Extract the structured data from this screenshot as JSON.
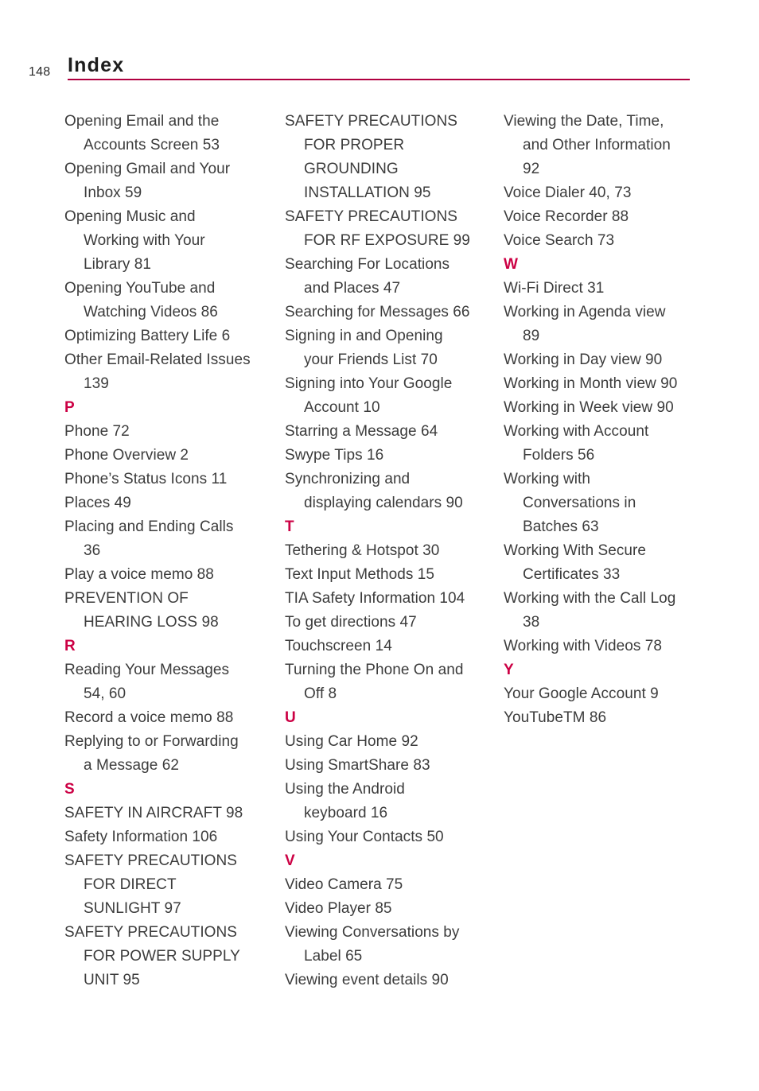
{
  "header": {
    "page_number": "148",
    "title": "Index",
    "rule_color": "#b00040"
  },
  "theme": {
    "letter_heading_color": "#cc0044",
    "text_color": "#3c3c3c",
    "background": "#ffffff"
  },
  "columns": [
    {
      "id": "column-1",
      "lines": [
        {
          "type": "entry",
          "text": "Opening Email and the",
          "indent": false
        },
        {
          "type": "entry",
          "text": "Accounts Screen 53",
          "indent": true
        },
        {
          "type": "entry",
          "text": "Opening Gmail and Your",
          "indent": false
        },
        {
          "type": "entry",
          "text": "Inbox 59",
          "indent": true
        },
        {
          "type": "entry",
          "text": "Opening Music and",
          "indent": false
        },
        {
          "type": "entry",
          "text": "Working with Your",
          "indent": true
        },
        {
          "type": "entry",
          "text": "Library 81",
          "indent": true
        },
        {
          "type": "entry",
          "text": "Opening YouTube and",
          "indent": false
        },
        {
          "type": "entry",
          "text": "Watching Videos 86",
          "indent": true
        },
        {
          "type": "entry",
          "text": "Optimizing Battery Life 6",
          "indent": false
        },
        {
          "type": "entry",
          "text": "Other Email-Related Issues",
          "indent": false
        },
        {
          "type": "entry",
          "text": "139",
          "indent": true
        },
        {
          "type": "letter",
          "text": "P",
          "indent": false
        },
        {
          "type": "entry",
          "text": "Phone 72",
          "indent": false
        },
        {
          "type": "entry",
          "text": "Phone Overview 2",
          "indent": false
        },
        {
          "type": "entry",
          "text": "Phone’s Status Icons 11",
          "indent": false
        },
        {
          "type": "entry",
          "text": "Places 49",
          "indent": false
        },
        {
          "type": "entry",
          "text": "Placing and Ending Calls",
          "indent": false
        },
        {
          "type": "entry",
          "text": "36",
          "indent": true
        },
        {
          "type": "entry",
          "text": "Play a voice memo 88",
          "indent": false
        },
        {
          "type": "entry",
          "text": "PREVENTION OF",
          "indent": false
        },
        {
          "type": "entry",
          "text": "HEARING LOSS 98",
          "indent": true
        },
        {
          "type": "letter",
          "text": "R",
          "indent": false
        },
        {
          "type": "entry",
          "text": "Reading Your Messages",
          "indent": false
        },
        {
          "type": "entry",
          "text": "54, 60",
          "indent": true
        },
        {
          "type": "entry",
          "text": "Record a voice memo 88",
          "indent": false
        },
        {
          "type": "entry",
          "text": "Replying to or Forwarding",
          "indent": false
        },
        {
          "type": "entry",
          "text": "a Message 62",
          "indent": true
        },
        {
          "type": "letter",
          "text": "S",
          "indent": false
        },
        {
          "type": "entry",
          "text": "SAFETY IN AIRCRAFT 98",
          "indent": false
        },
        {
          "type": "entry",
          "text": "Safety Information 106",
          "indent": false
        },
        {
          "type": "entry",
          "text": "SAFETY PRECAUTIONS",
          "indent": false
        },
        {
          "type": "entry",
          "text": "FOR DIRECT",
          "indent": true
        },
        {
          "type": "entry",
          "text": "SUNLIGHT 97",
          "indent": true
        },
        {
          "type": "entry",
          "text": "SAFETY PRECAUTIONS",
          "indent": false
        },
        {
          "type": "entry",
          "text": "FOR POWER SUPPLY",
          "indent": true
        },
        {
          "type": "entry",
          "text": "UNIT 95",
          "indent": true
        }
      ]
    },
    {
      "id": "column-2",
      "lines": [
        {
          "type": "entry",
          "text": "SAFETY PRECAUTIONS",
          "indent": false
        },
        {
          "type": "entry",
          "text": "FOR PROPER",
          "indent": true
        },
        {
          "type": "entry",
          "text": "GROUNDING",
          "indent": true
        },
        {
          "type": "entry",
          "text": "INSTALLATION 95",
          "indent": true
        },
        {
          "type": "entry",
          "text": "SAFETY PRECAUTIONS",
          "indent": false
        },
        {
          "type": "entry",
          "text": "FOR RF EXPOSURE 99",
          "indent": true
        },
        {
          "type": "entry",
          "text": "Searching For Locations",
          "indent": false
        },
        {
          "type": "entry",
          "text": "and Places 47",
          "indent": true
        },
        {
          "type": "entry",
          "text": "Searching for Messages 66",
          "indent": false
        },
        {
          "type": "entry",
          "text": "Signing in and Opening",
          "indent": false
        },
        {
          "type": "entry",
          "text": "your Friends List 70",
          "indent": true
        },
        {
          "type": "entry",
          "text": "Signing into Your Google",
          "indent": false
        },
        {
          "type": "entry",
          "text": "Account 10",
          "indent": true
        },
        {
          "type": "entry",
          "text": "Starring a Message 64",
          "indent": false
        },
        {
          "type": "entry",
          "text": "Swype Tips 16",
          "indent": false
        },
        {
          "type": "entry",
          "text": "Synchronizing and",
          "indent": false
        },
        {
          "type": "entry",
          "text": "displaying calendars 90",
          "indent": true
        },
        {
          "type": "letter",
          "text": "T",
          "indent": false
        },
        {
          "type": "entry",
          "text": "Tethering & Hotspot 30",
          "indent": false
        },
        {
          "type": "entry",
          "text": "Text Input Methods 15",
          "indent": false
        },
        {
          "type": "entry",
          "text": "TIA Safety Information 104",
          "indent": false
        },
        {
          "type": "entry",
          "text": "To get directions 47",
          "indent": false
        },
        {
          "type": "entry",
          "text": "Touchscreen 14",
          "indent": false
        },
        {
          "type": "entry",
          "text": "Turning the Phone On and",
          "indent": false
        },
        {
          "type": "entry",
          "text": "Off 8",
          "indent": true
        },
        {
          "type": "letter",
          "text": "U",
          "indent": false
        },
        {
          "type": "entry",
          "text": "Using Car Home 92",
          "indent": false
        },
        {
          "type": "entry",
          "text": "Using SmartShare 83",
          "indent": false
        },
        {
          "type": "entry",
          "text": "Using the Android",
          "indent": false
        },
        {
          "type": "entry",
          "text": "keyboard 16",
          "indent": true
        },
        {
          "type": "entry",
          "text": "Using Your Contacts 50",
          "indent": false
        },
        {
          "type": "letter",
          "text": "V",
          "indent": false
        },
        {
          "type": "entry",
          "text": "Video Camera 75",
          "indent": false
        },
        {
          "type": "entry",
          "text": "Video Player 85",
          "indent": false
        },
        {
          "type": "entry",
          "text": "Viewing Conversations by",
          "indent": false
        },
        {
          "type": "entry",
          "text": "Label 65",
          "indent": true
        },
        {
          "type": "entry",
          "text": "Viewing event details 90",
          "indent": false
        }
      ]
    },
    {
      "id": "column-3",
      "lines": [
        {
          "type": "entry",
          "text": "Viewing the Date, Time,",
          "indent": false
        },
        {
          "type": "entry",
          "text": "and Other Information",
          "indent": true
        },
        {
          "type": "entry",
          "text": "92",
          "indent": true
        },
        {
          "type": "entry",
          "text": "Voice Dialer 40, 73",
          "indent": false
        },
        {
          "type": "entry",
          "text": "Voice Recorder 88",
          "indent": false
        },
        {
          "type": "entry",
          "text": "Voice Search 73",
          "indent": false
        },
        {
          "type": "letter",
          "text": "W",
          "indent": false
        },
        {
          "type": "entry",
          "text": "Wi-Fi Direct 31",
          "indent": false
        },
        {
          "type": "entry",
          "text": "Working in Agenda view",
          "indent": false
        },
        {
          "type": "entry",
          "text": "89",
          "indent": true
        },
        {
          "type": "entry",
          "text": "Working in Day view 90",
          "indent": false
        },
        {
          "type": "entry",
          "text": "Working in Month view 90",
          "indent": false
        },
        {
          "type": "entry",
          "text": "Working in Week view 90",
          "indent": false
        },
        {
          "type": "entry",
          "text": "Working with Account",
          "indent": false
        },
        {
          "type": "entry",
          "text": "Folders 56",
          "indent": true
        },
        {
          "type": "entry",
          "text": "Working with",
          "indent": false
        },
        {
          "type": "entry",
          "text": "Conversations in",
          "indent": true
        },
        {
          "type": "entry",
          "text": "Batches 63",
          "indent": true
        },
        {
          "type": "entry",
          "text": "Working With Secure",
          "indent": false
        },
        {
          "type": "entry",
          "text": "Certificates 33",
          "indent": true
        },
        {
          "type": "entry",
          "text": "Working with the Call Log",
          "indent": false
        },
        {
          "type": "entry",
          "text": "38",
          "indent": true
        },
        {
          "type": "entry",
          "text": "Working with Videos 78",
          "indent": false
        },
        {
          "type": "letter",
          "text": "Y",
          "indent": false
        },
        {
          "type": "entry",
          "text": "Your Google Account 9",
          "indent": false
        },
        {
          "type": "entry",
          "text": "YouTubeTM 86",
          "indent": false
        }
      ]
    }
  ]
}
